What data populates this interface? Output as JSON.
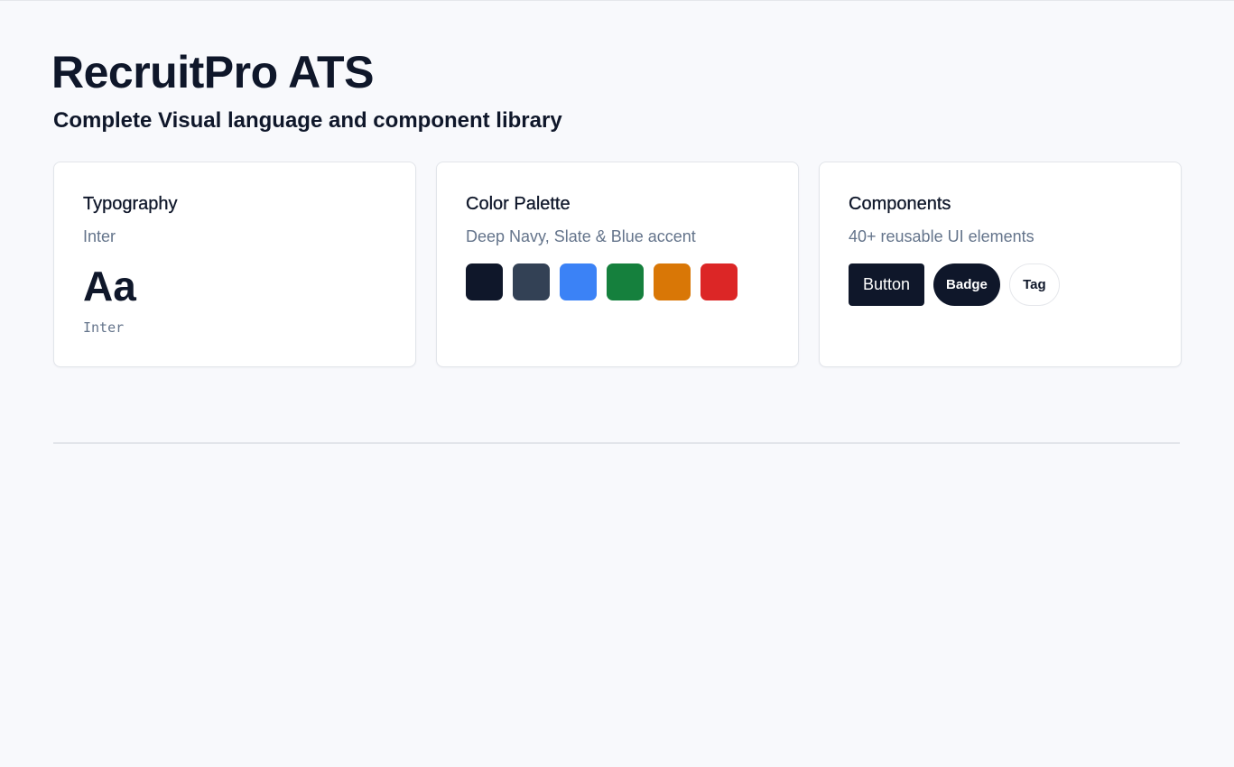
{
  "header": {
    "title": "RecruitPro ATS",
    "subtitle": "Complete Visual language and component library"
  },
  "cards": {
    "typography": {
      "title": "Typography",
      "subtitle": "Inter",
      "sample": "Aa",
      "mono_label": "Inter"
    },
    "color_palette": {
      "title": "Color Palette",
      "subtitle": "Deep Navy, Slate & Blue accent",
      "swatches": [
        "#0f172a",
        "#334155",
        "#3b82f6",
        "#15803d",
        "#d97706",
        "#dc2626"
      ]
    },
    "components": {
      "title": "Components",
      "subtitle": "40+ reusable UI elements",
      "button_label": "Button",
      "badge_label": "Badge",
      "tag_label": "Tag"
    }
  },
  "colors": {
    "background": "#f8f9fc",
    "primary": "#0f172a",
    "muted_text": "#64748b",
    "border": "#e2e5ea"
  }
}
